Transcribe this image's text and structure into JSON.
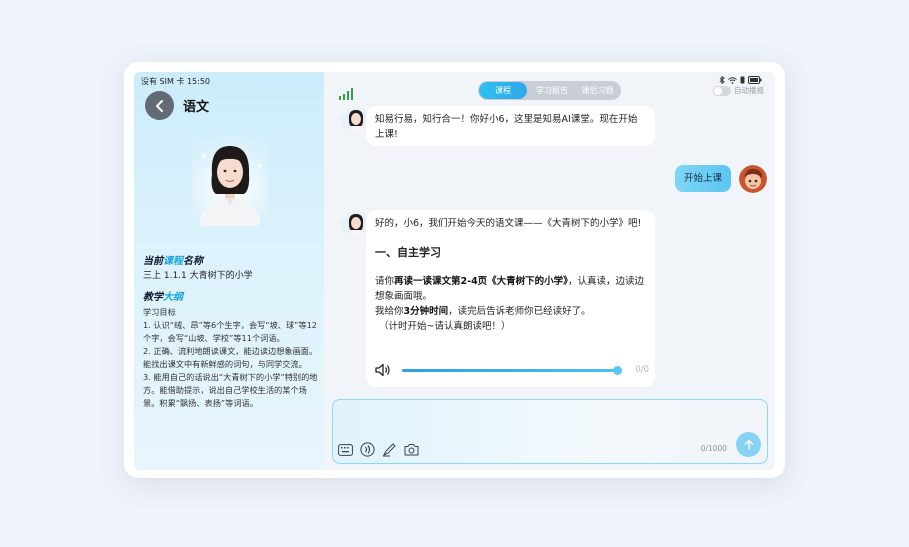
{
  "status_bar": {
    "carrier_time": "没有 SIM 卡 15:50"
  },
  "left_panel": {
    "subject": "语文",
    "course_section": {
      "title_a": "当前",
      "title_b": "课程",
      "title_c": "名称",
      "course_name": "三上 1.1.1 大青树下的小学"
    },
    "outline_section": {
      "title_a": "教学",
      "title_b": "大纲",
      "goal_heading": "学习目标",
      "goals": [
        "1. 认识“绒、昂”等6个生字，会写“坡、球”等12个字，会写“山坡、学校”等11个词语。",
        "2. 正确、流利地朗读课文，能边读边想象画面。能找出课文中有新鲜感的词句，与同学交流。",
        "3. 能用自己的话说出“大青树下的小学”特别的地方。能借助提示，说出自己学校生活的某个场景。积累“飘扬、表扬”等词语。"
      ]
    }
  },
  "tabs": [
    {
      "label": "课程",
      "active": true
    },
    {
      "label": "学习报告",
      "active": false
    },
    {
      "label": "课后习题",
      "active": false
    }
  ],
  "autoplay": {
    "label": "自动播报",
    "on": false
  },
  "chat": {
    "msg1": "知易行易，知行合一！你好小6，这里是知易AI课堂。现在开始上课!",
    "user_msg": "开始上课",
    "msg3": {
      "intro": "好的，小6，我们开始今天的语文课——《大青树下的小学》吧!",
      "heading": "一、自主学习",
      "p1_pre": "请你",
      "p1_bold": "再读一读课文第2-4页《大青树下的小学》",
      "p1_post": "，认真读，边读边想象画面哦。",
      "p2_pre": "我给你",
      "p2_bold": "3分钟时间",
      "p2_post": "，读完后告诉老师你已经读好了。",
      "p3": "（计时开始~请认真朗读吧！）",
      "audio_time": "0/0",
      "audio_progress": 1.0
    }
  },
  "input": {
    "counter": "0/1000"
  },
  "colors": {
    "accent": "#2fb2ec",
    "panel_bg": "#ccecfb",
    "user_bubble": "#6ccdf3"
  }
}
